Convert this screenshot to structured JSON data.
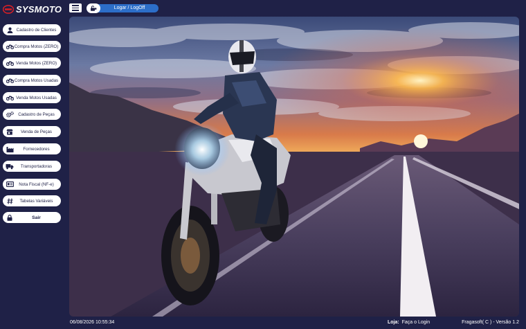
{
  "app": {
    "brand": "SYSMOTO",
    "accent": "#2c6ec9",
    "background": "#1f2147",
    "brand_red": "#d51f25"
  },
  "header": {
    "login_label": "Logar / LogOff",
    "icons": [
      "menu-icon",
      "lock-icon"
    ]
  },
  "sidebar": {
    "items": [
      {
        "label": "Cadastro de Clientes",
        "icon": "user-icon"
      },
      {
        "label": "Compra Motos (ZERO)",
        "icon": "motorcycle-icon"
      },
      {
        "label": "Venda Motos (ZERO)",
        "icon": "motorcycle-icon"
      },
      {
        "label": "Compra Motos Usadas",
        "icon": "motorcycle-icon"
      },
      {
        "label": "Venda Motos Usadas",
        "icon": "motorcycle-icon"
      },
      {
        "label": "Cadastro de Peças",
        "icon": "gears-icon"
      },
      {
        "label": "Venda de Peças",
        "icon": "store-icon"
      },
      {
        "label": "Fornecedores",
        "icon": "factory-icon"
      },
      {
        "label": "Transportadoras",
        "icon": "truck-icon"
      },
      {
        "label": "Nota Fiscal (NF-e)",
        "icon": "id-card-icon"
      },
      {
        "label": "Tabelas Variáveis",
        "icon": "hash-icon"
      },
      {
        "label": "Sair",
        "icon": "lock-icon"
      }
    ]
  },
  "main": {
    "image": "motorcycle-rider-on-road-at-sunset"
  },
  "status": {
    "datetime": "06/08/2026 10:55:34",
    "store_label": "Loja:",
    "store_value": "Faça o Login",
    "copyright": "Fragasoft( C ) - Versão 1.2"
  }
}
